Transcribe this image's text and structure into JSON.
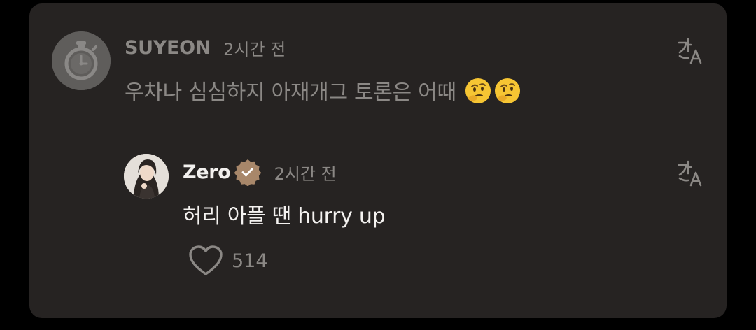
{
  "comment": {
    "username": "SUYEON",
    "timestamp": "2시간 전",
    "text": "우차나 심심하지 아재개그 토론은 어때",
    "emojis": [
      "thinking-face-emoji",
      "thinking-face-emoji"
    ]
  },
  "reply": {
    "username": "Zero",
    "verified": true,
    "timestamp": "2시간 전",
    "text": "허리 아플 땐 hurry up",
    "likes": "514"
  },
  "icons": {
    "translate": "translate-icon",
    "heart": "heart-icon",
    "verified": "verified-badge-icon"
  },
  "colors": {
    "background": "#000000",
    "card": "#262322",
    "muted_text": "#8b8885",
    "primary_text": "#f4f2f0",
    "verified_badge": "#a8876a"
  }
}
